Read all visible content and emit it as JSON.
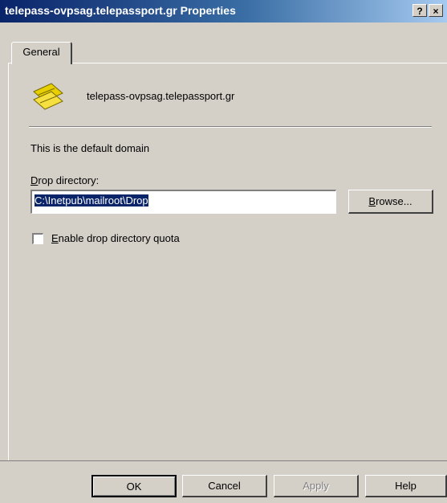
{
  "window": {
    "title": "telepass-ovpsag.telepassport.gr Properties",
    "help_button": "?",
    "close_button": "×"
  },
  "tabs": [
    {
      "label": "General",
      "selected": true
    }
  ],
  "general": {
    "domain_name": "telepass-ovpsag.telepassport.gr",
    "default_domain_text": "This is the default domain",
    "drop_directory": {
      "label_prefix": "D",
      "label_rest": "rop directory:",
      "value": "C:\\Inetpub\\mailroot\\Drop",
      "browse_prefix": "B",
      "browse_rest": "rowse..."
    },
    "quota": {
      "label_prefix": "E",
      "label_rest": "nable drop directory quota",
      "checked": false
    }
  },
  "footer": {
    "ok": "OK",
    "cancel": "Cancel",
    "apply": "Apply",
    "help": "Help"
  },
  "colors": {
    "title_bar_start": "#0a246a",
    "title_bar_end": "#a6caf0",
    "dialog_face": "#d4d0c8",
    "selection": "#0a246a"
  }
}
